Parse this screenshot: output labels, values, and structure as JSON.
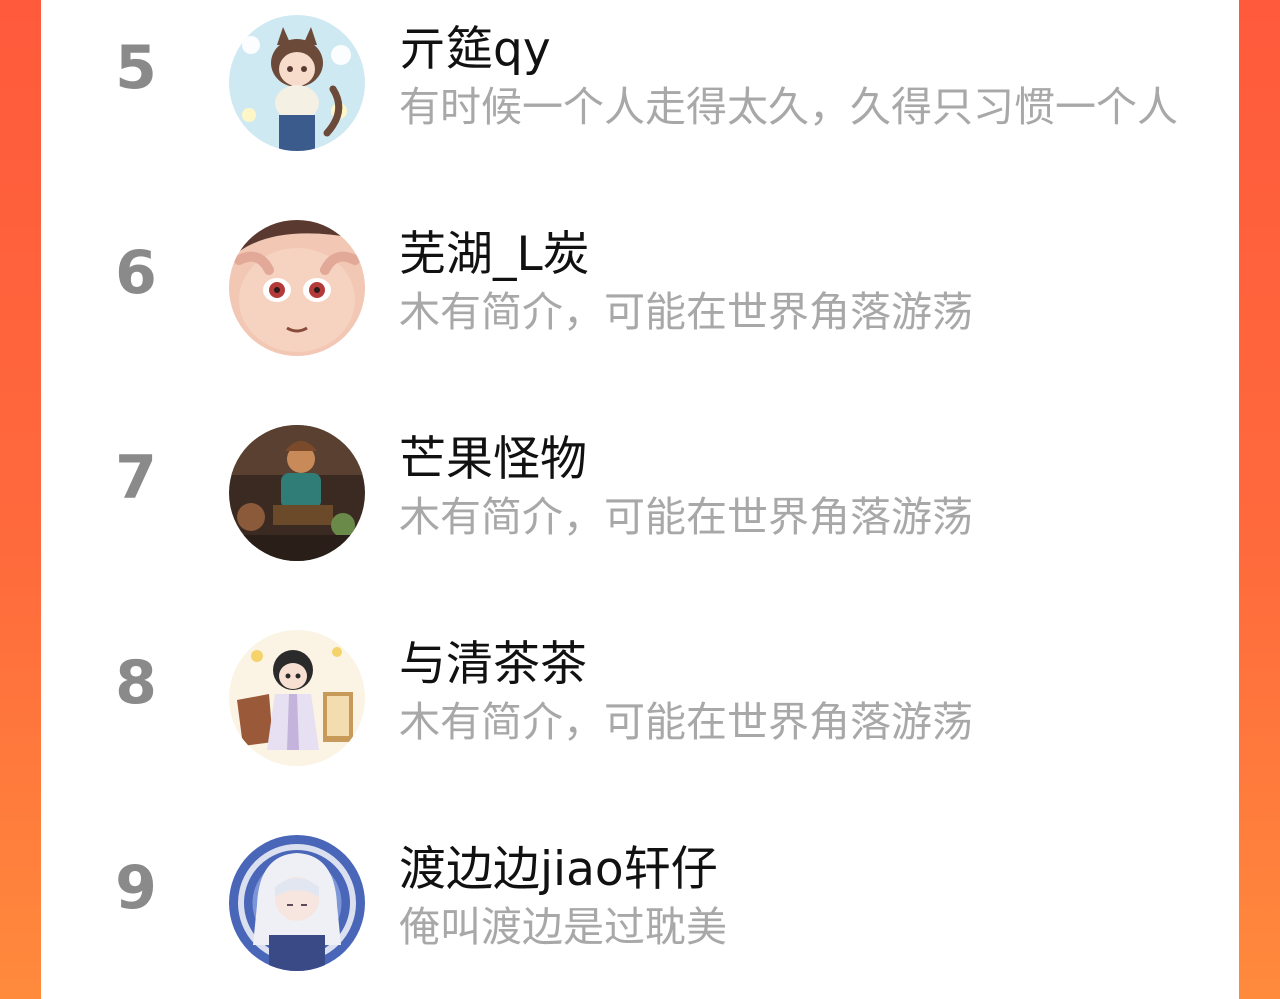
{
  "colors": {
    "background_gradient_top": "#ff5a3c",
    "background_gradient_bottom": "#ff8a3c",
    "panel": "#ffffff",
    "rank": "#8a8a8a",
    "name": "#111111",
    "bio": "#a8a8a8"
  },
  "ranking": {
    "items": [
      {
        "rank": "5",
        "name": "亓筵qy",
        "bio": "有时候一个人走得太久，久得只习惯一个人",
        "avatar": "cat-ear-girl-avatar"
      },
      {
        "rank": "6",
        "name": "芜湖_L炭",
        "bio": "木有简介，可能在世界角落游荡",
        "avatar": "cartoon-face-avatar"
      },
      {
        "rank": "7",
        "name": "芒果怪物",
        "bio": "木有简介，可能在世界角落游荡",
        "avatar": "painting-avatar"
      },
      {
        "rank": "8",
        "name": "与清茶茶",
        "bio": "木有简介，可能在世界角落游荡",
        "avatar": "chibi-girl-avatar"
      },
      {
        "rank": "9",
        "name": "渡边边jiao轩仔",
        "bio": "俺叫渡边是过耽美",
        "avatar": "white-hair-character-avatar"
      }
    ]
  }
}
